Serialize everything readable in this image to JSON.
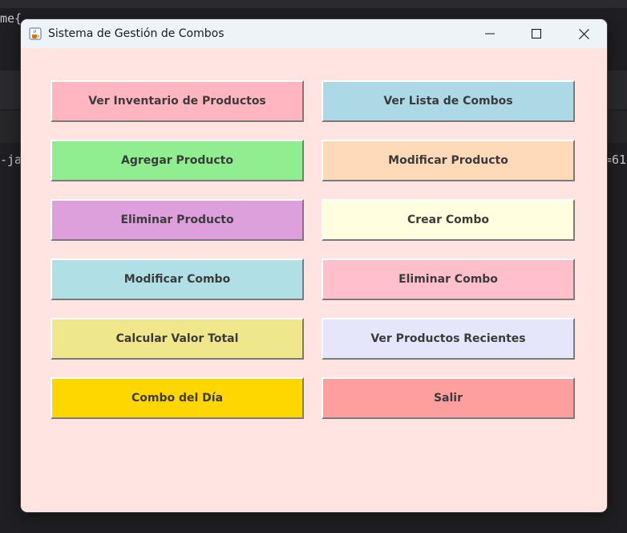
{
  "background": {
    "fragment_top": "me{",
    "fragment_left": "-ja",
    "fragment_right": "=61"
  },
  "window": {
    "title": "Sistema de Gestión de Combos",
    "app_icon": "java-cup-icon",
    "controls": {
      "minimize_icon": "minimize-icon",
      "maximize_icon": "maximize-icon",
      "close_icon": "close-icon"
    }
  },
  "buttons": [
    {
      "label": "Ver Inventario de Productos",
      "color": "#ffb6c1"
    },
    {
      "label": "Ver Lista de Combos",
      "color": "#add8e6"
    },
    {
      "label": "Agregar Producto",
      "color": "#90ee90"
    },
    {
      "label": "Modificar Producto",
      "color": "#ffdab9"
    },
    {
      "label": "Eliminar Producto",
      "color": "#dda0dd"
    },
    {
      "label": "Crear Combo",
      "color": "#ffffe0"
    },
    {
      "label": "Modificar Combo",
      "color": "#b0e0e6"
    },
    {
      "label": "Eliminar Combo",
      "color": "#ffc0cb"
    },
    {
      "label": "Calcular Valor Total",
      "color": "#f0e68c"
    },
    {
      "label": "Ver Productos Recientes",
      "color": "#e6e6fa"
    },
    {
      "label": "Combo del Día",
      "color": "#ffd700"
    },
    {
      "label": "Salir",
      "color": "#ff9e9e"
    }
  ],
  "colors": {
    "window_background": "#ffe4e1",
    "titlebar": "#eef3f8"
  }
}
